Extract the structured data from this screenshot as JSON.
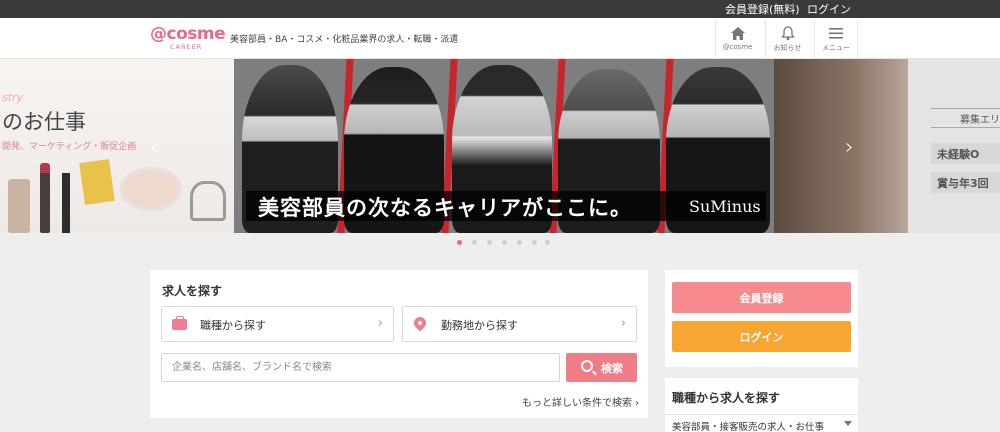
{
  "topbar": {
    "register_label": "会員登録(無料)",
    "login_label": "ログイン"
  },
  "header": {
    "logo_main": "@cosme",
    "logo_sub": "CAREER",
    "tagline": "美容部員・BA・コスメ・化粧品業界の求人・転職・派遣",
    "nav": [
      {
        "label": "@cosme",
        "icon": "home-icon"
      },
      {
        "label": "お知らせ",
        "icon": "bell-icon"
      },
      {
        "label": "メニュー",
        "icon": "menu-icon"
      }
    ]
  },
  "hero": {
    "left_ghost": "stry",
    "left_title": "のお仕事",
    "left_sub": "開発、マーケティング・販促企画",
    "catch": "美容部員の次なるキャリアがここに。",
    "brand": "SuMinus",
    "right_top": "募集エリ",
    "right_pill_1": "未経験O",
    "right_pill_2": "賞与年3回",
    "prev_arrow": "‹",
    "next_arrow": "›",
    "slide_count": 7,
    "active_slide": 1
  },
  "search": {
    "title": "求人を探す",
    "job_type_label": "職種から探す",
    "location_label": "勤務地から探す",
    "keyword_placeholder": "企業名、店舗名、ブランド名で検索",
    "search_button": "検索",
    "more_link": "もっと詳しい条件で検索 ›"
  },
  "auth": {
    "register_button": "会員登録",
    "login_button": "ログイン"
  },
  "categories": {
    "title": "職種から求人を探す",
    "first_item": "美容部員・接客販売の求人・お仕事"
  },
  "colors": {
    "brand_pink": "#e96a86",
    "register_pink": "#f58a8f",
    "login_orange": "#f8a632",
    "topbar": "#3a3a3a"
  }
}
